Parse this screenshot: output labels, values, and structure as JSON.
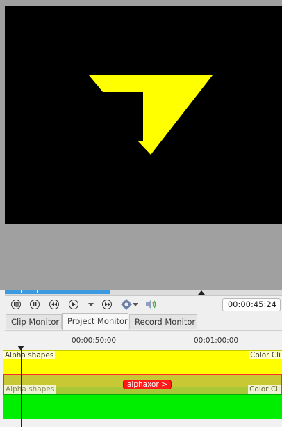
{
  "colors": {
    "canvas_bg": "#000000",
    "shape_fill": "#ffff00",
    "progress_blue": "#3c9ae0",
    "track_yellow": "#ffff00",
    "track_green": "#00ee00",
    "effect_red": "#ff1a1a"
  },
  "monitor": {
    "progress_fraction": 0.38,
    "cursor_fraction": 0.71
  },
  "transport": {
    "buttons": [
      {
        "name": "go-to-start",
        "icon": "skip-start-icon"
      },
      {
        "name": "step-back",
        "icon": "step-back-icon"
      },
      {
        "name": "rewind",
        "icon": "rewind-icon"
      },
      {
        "name": "play",
        "icon": "play-icon"
      },
      {
        "name": "fast-forward",
        "icon": "fast-forward-icon"
      }
    ],
    "timecode": "00:00:45:24"
  },
  "tabs": [
    {
      "label": "Clip Monitor",
      "active": false
    },
    {
      "label": "Project Monitor",
      "active": true
    },
    {
      "label": "Record Monitor",
      "active": false
    }
  ],
  "timeline": {
    "ruler_labels": [
      "00:00:50:00",
      "00:01:00:00"
    ],
    "tracks": [
      {
        "clip_left": "Alpha shapes",
        "clip_right": "Color Cli"
      },
      {
        "clip_left": "Alpha shapes",
        "clip_right": "Color Cli"
      }
    ],
    "effect_label": "alphaxor|>"
  }
}
